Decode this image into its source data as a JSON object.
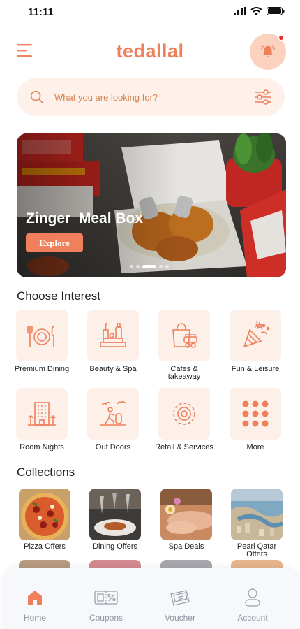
{
  "status": {
    "time": "11:11"
  },
  "header": {
    "title": "tedallal"
  },
  "search": {
    "placeholder": "What you are looking for?"
  },
  "banner": {
    "title": "Zinger  Meal Box",
    "button_label": "Explore",
    "slide_count": 5,
    "active_slide": 2
  },
  "interests": {
    "title": "Choose Interest",
    "items": [
      {
        "label": "Premium Dining",
        "icon": "dining-icon"
      },
      {
        "label": "Beauty & Spa",
        "icon": "spa-icon"
      },
      {
        "label": "Cafes & takeaway",
        "icon": "cafe-icon"
      },
      {
        "label": "Fun & Leisure",
        "icon": "party-icon"
      },
      {
        "label": "Room Nights",
        "icon": "hotel-icon"
      },
      {
        "label": "Out Doors",
        "icon": "outdoor-icon"
      },
      {
        "label": "Retail & Services",
        "icon": "retail-icon"
      },
      {
        "label": "More",
        "icon": "more-grid-icon"
      }
    ]
  },
  "collections": {
    "title": "Collections",
    "items": [
      {
        "label": "Pizza Offers"
      },
      {
        "label": "Dining Offers"
      },
      {
        "label": "Spa Deals"
      },
      {
        "label": "Pearl Qatar Offers"
      }
    ]
  },
  "bottom_nav": {
    "active": "Home",
    "items": [
      {
        "label": "Home",
        "icon": "home-icon"
      },
      {
        "label": "Coupons",
        "icon": "coupon-icon"
      },
      {
        "label": "Voucher",
        "icon": "voucher-icon"
      },
      {
        "label": "Account",
        "icon": "account-icon"
      }
    ]
  },
  "colors": {
    "accent": "#f07f5c",
    "tile_bg": "#fdf0e8",
    "search_bg": "#fdf1ea",
    "bell_bg": "#fbd2bd",
    "nav_text": "#8f96a1"
  }
}
